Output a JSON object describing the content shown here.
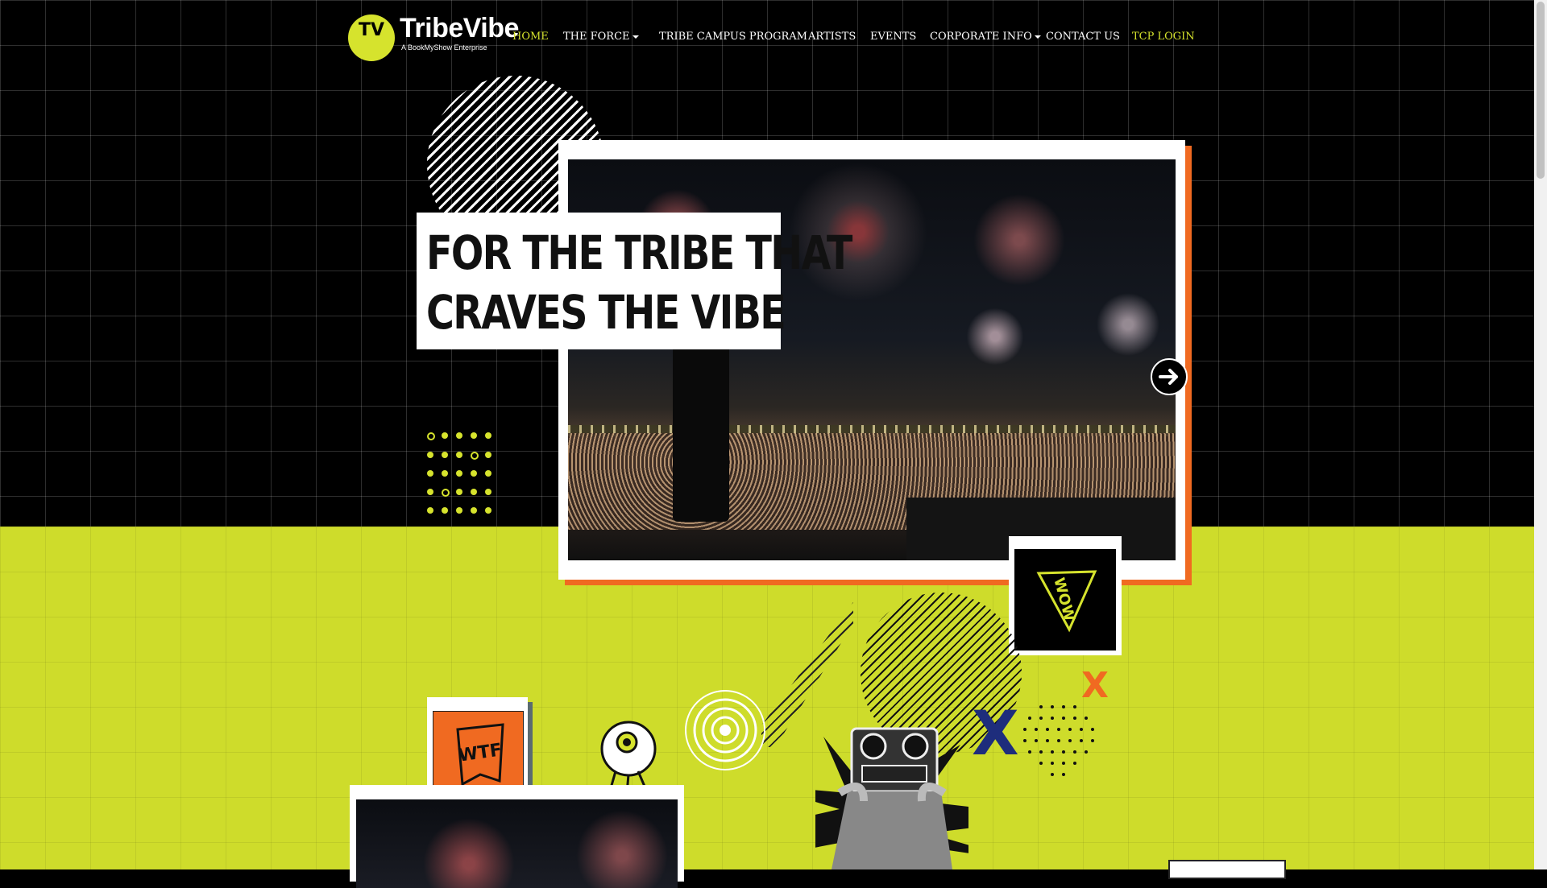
{
  "brand": {
    "name": "TribeVibe",
    "tagline": "A BookMyShow Enterprise",
    "badge_glyph": "TV",
    "accent_color": "#d6e32d",
    "orange_color": "#f06a21"
  },
  "nav": {
    "items": [
      {
        "label": "HOME",
        "active": true,
        "dropdown": false
      },
      {
        "label": "THE FORCE",
        "active": false,
        "dropdown": true
      },
      {
        "label": "TRIBE CAMPUS PROGRAM",
        "active": false,
        "dropdown": false
      },
      {
        "label": "ARTISTS",
        "active": false,
        "dropdown": false
      },
      {
        "label": "EVENTS",
        "active": false,
        "dropdown": false
      },
      {
        "label": "CORPORATE INFO",
        "active": false,
        "dropdown": true
      },
      {
        "label": "CONTACT US",
        "active": false,
        "dropdown": false
      },
      {
        "label": "TCP LOGIN",
        "active": false,
        "dropdown": false,
        "accent": true
      }
    ]
  },
  "hero": {
    "headline_line1": "FOR THE TRIBE THAT",
    "headline_line2": "CRAVES THE VIBE",
    "next_icon": "arrow-right-icon"
  },
  "stickers": {
    "wow": "WOW",
    "wtf": "WTF",
    "x_mark": "X"
  }
}
